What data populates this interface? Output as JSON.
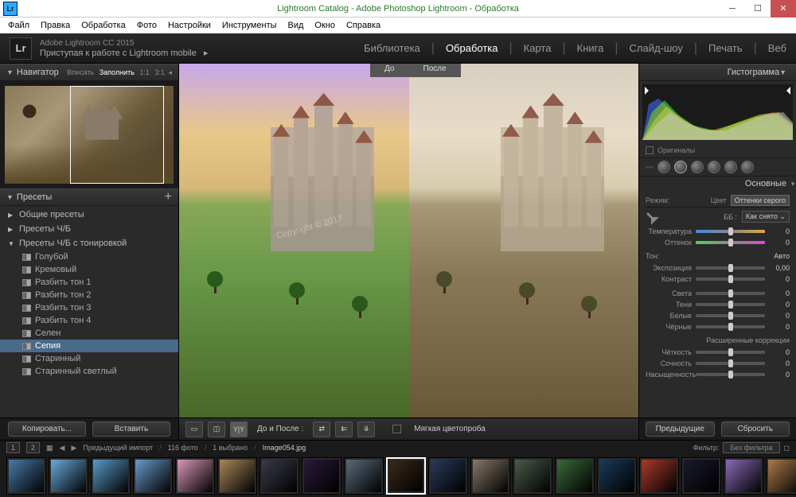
{
  "window": {
    "title": "Lightroom Catalog - Adobe Photoshop Lightroom - Обработка"
  },
  "menu": [
    "Файл",
    "Правка",
    "Обработка",
    "Фото",
    "Настройки",
    "Инструменты",
    "Вид",
    "Окно",
    "Справка"
  ],
  "brand": {
    "line1": "Adobe Lightroom CC 2015",
    "line2": "Приступая к работе с Lightroom mobile"
  },
  "modules": [
    "Библиотека",
    "Обработка",
    "Карта",
    "Книга",
    "Слайд-шоу",
    "Печать",
    "Веб"
  ],
  "activeModule": 1,
  "navigator": {
    "title": "Навигатор",
    "opts": [
      "Вписать",
      "Заполнить",
      "1:1",
      "3:1"
    ]
  },
  "presets": {
    "title": "Пресеты",
    "groups": [
      {
        "label": "Общие пресеты",
        "open": false
      },
      {
        "label": "Пресеты Ч/Б",
        "open": false
      },
      {
        "label": "Пресеты Ч/Б с тонировкой",
        "open": true,
        "items": [
          "Голубой",
          "Кремовый",
          "Разбить тон 1",
          "Разбить тон 2",
          "Разбить тон 3",
          "Разбить тон 4",
          "Селен",
          "Сепия",
          "Старинный",
          "Старинный светлый"
        ],
        "selected": 7
      }
    ]
  },
  "leftButtons": {
    "copy": "Копировать...",
    "paste": "Вставить"
  },
  "beforeAfter": {
    "before": "До",
    "after": "После"
  },
  "toolbar": {
    "mode": "До и После :",
    "softproof": "Мягкая цветопроба"
  },
  "histogram": {
    "title": "Гистограмма",
    "originals": "Оригиналы"
  },
  "basic": {
    "title": "Основные",
    "modeLabel": "Режим:",
    "color": "Цвет",
    "grayscale": "Оттенки серого",
    "wbLabel": "ББ :",
    "wbValue": "Как снято",
    "sliders": {
      "temp": {
        "label": "Температура",
        "value": "0"
      },
      "tint": {
        "label": "Оттенок",
        "value": "0"
      },
      "toneHdr": "Тон:",
      "auto": "Авто",
      "exposure": {
        "label": "Экспозиция",
        "value": "0,00"
      },
      "contrast": {
        "label": "Контраст",
        "value": "0"
      },
      "highlights": {
        "label": "Света",
        "value": "0"
      },
      "shadows": {
        "label": "Тени",
        "value": "0"
      },
      "whites": {
        "label": "Белые",
        "value": "0"
      },
      "blacks": {
        "label": "Чёрные",
        "value": "0"
      },
      "presenceHdr": "Расширенные коррекции",
      "clarity": {
        "label": "Чёткость",
        "value": "0"
      },
      "vibrance": {
        "label": "Сочность",
        "value": "0"
      },
      "saturation": {
        "label": "Насыщенность",
        "value": "0"
      }
    }
  },
  "rightButtons": {
    "prev": "Предыдущие",
    "reset": "Сбросить"
  },
  "filmstrip": {
    "nums": [
      "1",
      "2"
    ],
    "prev": "Предыдущий импорт",
    "count": "116 фото",
    "sel": "1 выбрано",
    "file": "Image054.jpg",
    "filterLabel": "Фильтр:",
    "filterValue": "Без фильтра"
  },
  "thumbColors": [
    "#4a7aaa",
    "#6aaada",
    "#5a9ac8",
    "#6a9aca",
    "#d898b8",
    "#a8885a",
    "#3a3a4a",
    "#2a1a3a",
    "#5a6a7a",
    "#3a2a1a",
    "#2a3a5a",
    "#887868",
    "#4a5a4a",
    "#3a6a3a",
    "#1a3a5a",
    "#aa3a2a",
    "#1a1a2a",
    "#8a6ab8",
    "#aa7a4a",
    "#ca8a4a"
  ]
}
